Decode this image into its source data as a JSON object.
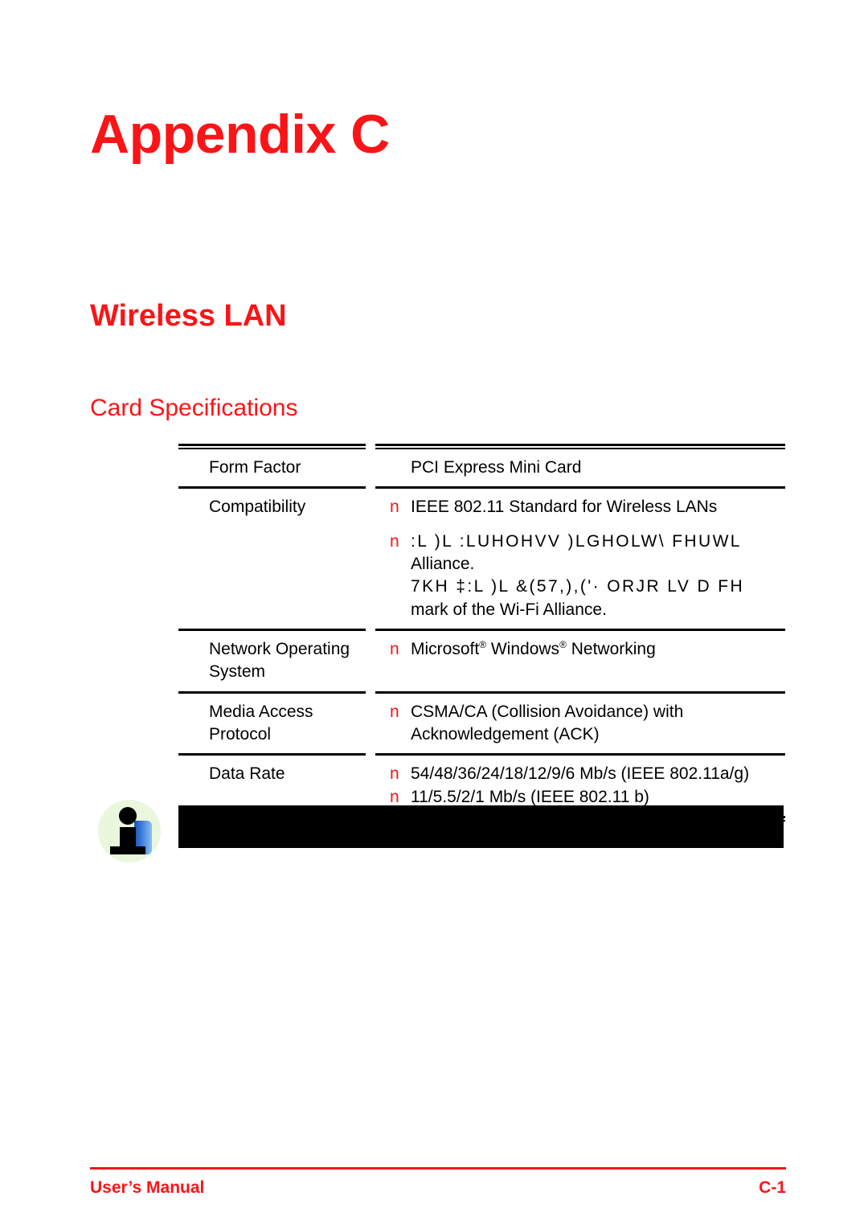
{
  "page": {
    "appendix_title": "Appendix C",
    "section_title": "Wireless LAN",
    "sub_title": "Card Specifications"
  },
  "spec_table": {
    "rows": [
      {
        "label": "Form Factor",
        "values": [
          {
            "bullet": "",
            "text": "PCI Express Mini Card"
          }
        ]
      },
      {
        "label": "Compatibility",
        "values": [
          {
            "bullet": "n",
            "text": "IEEE 802.11 Standard for Wireless LANs"
          },
          {
            "bullet": "n",
            "text": ":L )L :LUHOHVV )LGHOLW\\ FHUWL",
            "garbled": true
          },
          {
            "bullet": "",
            "text": "Alliance."
          },
          {
            "bullet": "",
            "text": "7KH ‡:L )L &(57,),('· ORJR LV D FH",
            "garbled": true
          },
          {
            "bullet": "",
            "text": "mark of the Wi-Fi Alliance."
          }
        ]
      },
      {
        "label": "Network Operating System",
        "label_lines": [
          "Network Operating",
          "System"
        ],
        "values": [
          {
            "bullet": "n",
            "text": "Microsoft® Windows® Networking"
          }
        ]
      },
      {
        "label": "Media Access Protocol",
        "label_lines": [
          "Media Access",
          "Protocol"
        ],
        "values": [
          {
            "bullet": "n",
            "text": "CSMA/CA (Collision Avoidance) with"
          },
          {
            "bullet": "",
            "text": "Acknowledgement (ACK)"
          }
        ]
      },
      {
        "label": "Data Rate",
        "values": [
          {
            "bullet": "n",
            "text": "54/48/36/24/18/12/9/6 Mb/s (IEEE 802.11a/g)"
          },
          {
            "bullet": "n",
            "text": "11/5.5/2/1 Mb/s (IEEE 802.11 b)"
          }
        ]
      }
    ]
  },
  "note": {
    "icon": "info-icon",
    "redacted_text": ""
  },
  "footer": {
    "left": "User’s Manual",
    "right": "C-1"
  },
  "colors": {
    "accent_red": "#fb1417",
    "bullet_red": "#fb1417",
    "rule_black": "#000000",
    "icon_circle": "#eaf7dc",
    "icon_blue": "#1a4fb4"
  }
}
